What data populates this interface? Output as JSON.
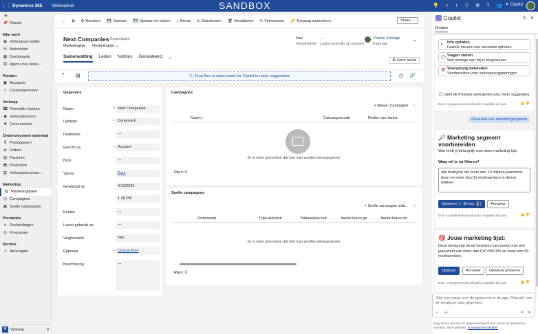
{
  "topbar": {
    "brand": "Dynamics 365",
    "app": "Verkoophub",
    "env": "SANDBOX",
    "copilot_label": "Copilot"
  },
  "sidebar": {
    "pinned": "Pinned",
    "sections": [
      {
        "title": "Mijn werk",
        "items": [
          "Verkoopversneller",
          "Activiteiten",
          "Dashboards",
          "Agent voor verko..."
        ]
      },
      {
        "title": "Klanten",
        "items": [
          "Accounts",
          "Contactpersonen"
        ]
      },
      {
        "title": "Verkoop",
        "items": [
          "Potentiële klanten",
          "Verkoopkansen",
          "Concurrenten"
        ]
      },
      {
        "title": "Ondersteunend materiaal",
        "items": [
          "Prijsopgaven",
          "Orders",
          "Facturen",
          "Producten",
          "Verkoopdocumen..."
        ]
      },
      {
        "title": "Marketing",
        "items": [
          "Marketinglijsten",
          "Campagnes",
          "Snelle campagnes"
        ]
      },
      {
        "title": "Prestaties",
        "items": [
          "Doelstellingen",
          "Prognoses"
        ]
      },
      {
        "title": "Service",
        "items": [
          "Aanvragen"
        ]
      }
    ],
    "area": "Verkoop"
  },
  "cmd": {
    "back": "←",
    "buttons": [
      "Boosters",
      "Opslaan",
      "Opslaan en sluiten",
      "+ Nieuw",
      "Deactiveren",
      "Verwijderen",
      "Vernieuwen",
      "Toegang controleren"
    ],
    "share": "Share"
  },
  "header": {
    "title": "Next Companies",
    "saved": "- Opgeslagen",
    "entity": "Marketinglijst",
    "form": "Marketinglijst",
    "locked_value": "Nee",
    "locked_label": "Vergrendeld",
    "lastused_value": "---",
    "lastused_label": "Laatst gebruikt op (datum)",
    "owner_name": "Charon Konings",
    "owner_label": "Eigenaar",
    "tabs": [
      "Samenvatting",
      "Leden",
      "Notities",
      "Gerelateerd"
    ],
    "form_assist": "Form assist"
  },
  "dropzone": "Drop files or smart paste for Copilot to make suggestions",
  "general": {
    "title": "Gegevens",
    "rows": [
      {
        "label": "Naam",
        "req": "*",
        "value": "Next Companies"
      },
      {
        "label": "Lijsttype",
        "req": "*",
        "value": "Dynamisch"
      },
      {
        "label": "Doeleinde",
        "req": "",
        "value": "---"
      },
      {
        "label": "Gericht op",
        "req": "*",
        "value": "Account"
      },
      {
        "label": "Bron",
        "req": "",
        "value": "---"
      },
      {
        "label": "Valuta",
        "req": "",
        "value": "Euro"
      },
      {
        "label": "Gewijzigd op",
        "req": "",
        "value": "4/13/2026"
      },
      {
        "label": "",
        "req": "",
        "value": "1:28 PM"
      },
      {
        "label": "Kosten",
        "req": "",
        "value": "---"
      },
      {
        "label": "Laatst gebruikt op",
        "req": "",
        "value": "---"
      },
      {
        "label": "Vergrendeld",
        "req": "",
        "value": "Nee"
      },
      {
        "label": "Eigenaar",
        "req": "*",
        "value": "Charon Koni"
      },
      {
        "label": "Beschrijving",
        "req": "",
        "value": "---"
      }
    ]
  },
  "campaigns": {
    "title": "Campagnes",
    "new": "Nieuw: Campagne",
    "cols": [
      "Naam ↑",
      "Campagnecode",
      "Reden van status"
    ],
    "empty": "Er is niets gevonden dat hier kan worden weergegeven",
    "rows": "Rijen: 0"
  },
  "quick": {
    "title": "Snelle campagnes",
    "new": "Snelle campagne mak...",
    "cols": [
      "Onderwerp",
      "Type activiteit",
      "Totaalaantal led...",
      "Aantal keren ge...",
      "Aantal keren mi."
    ],
    "empty": "Er is niets gevonden dat hier kan worden weergegeven",
    "rows": "Rijen: 0"
  },
  "copilot": {
    "title": "Copilot",
    "tab": "Chatten",
    "suggestions": [
      {
        "t": "Info ophalen",
        "d": "Laatste nieuws over accounts ophalen"
      },
      {
        "t": "Vragen stellen",
        "d": "Wat onlangs aan mij is toegewezen"
      },
      {
        "t": "Voorsprong behouden",
        "d": "Voorbereiden voor verkoopvergaderingen"
      }
    ],
    "prompts_tip": "Gebruik Prompts weergeven voor meer suggesties.",
    "disclaimer": "Door AI gegenereerde inhoud is mogelijk niet juist",
    "user_msg": "Genereer een marketingsegment",
    "seg_title": "Marketing segment voorbereiden",
    "seg_sub": "Wat vindt jij belangrijk voor deze marketing lijst.",
    "seg_q": "Waar wil je op filteren?",
    "seg_text": "alle bedrijven die meer dan 10 miljoen jaarozmet doen en meer dan 50 medewerkers in dienst hebben",
    "gen_btn": "Genereer (~ 30 sec ⏳)",
    "cancel_btn": "Annuleer",
    "list_title": "Jouw marketing lijst:",
    "list_text": "Deze doelgroep bevat bedrijven (accounts) met een jaarozmet van meer dan €10.000.000 en meer dan 50 medewerkers.",
    "save_btn": "Opslaan",
    "cancel2_btn": "Annuleer",
    "retry_btn": "Opnieuw proberen",
    "input_ph": "Stel een vraag over de gegevens in de app. Gebruik / om te verwijzen naar gegevens",
    "footer": "Zorg ervoor dat door AI gegenereerde inhoud correct en passend is voordat u deze gebruikt.",
    "footer_link": "Voorwaarden bekijken"
  }
}
